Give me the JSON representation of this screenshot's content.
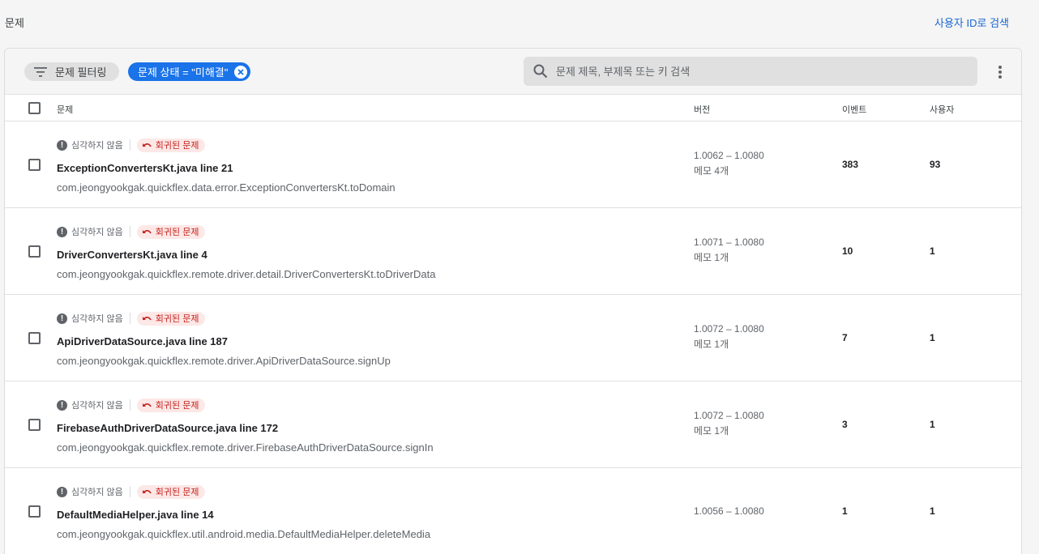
{
  "page_title": "문제",
  "search_by_id_link": "사용자 ID로 검색",
  "toolbar": {
    "filter_chip_label": "문제 필터링",
    "status_chip_label": "문제 상태 = \"미해결\"",
    "search_placeholder": "문제 제목, 부제목 또는 키 검색"
  },
  "columns": {
    "issue": "문제",
    "version": "버전",
    "events": "이벤트",
    "users": "사용자"
  },
  "colors": {
    "accent": "#1a73e8",
    "link": "#1967d2",
    "regressed_bg": "#fce8e6",
    "regressed_text": "#c5221f"
  },
  "issues": [
    {
      "severity": "심각하지 않음",
      "badge": "회귀된 문제",
      "title": "ExceptionConvertersKt.java line 21",
      "subtitle": "com.jeongyookgak.quickflex.data.error.ExceptionConvertersKt.toDomain",
      "version_range": "1.0062 – 1.0080",
      "notes": "메모 4개",
      "events": "383",
      "users": "93"
    },
    {
      "severity": "심각하지 않음",
      "badge": "회귀된 문제",
      "title": "DriverConvertersKt.java line 4",
      "subtitle": "com.jeongyookgak.quickflex.remote.driver.detail.DriverConvertersKt.toDriverData",
      "version_range": "1.0071 – 1.0080",
      "notes": "메모 1개",
      "events": "10",
      "users": "1"
    },
    {
      "severity": "심각하지 않음",
      "badge": "회귀된 문제",
      "title": "ApiDriverDataSource.java line 187",
      "subtitle": "com.jeongyookgak.quickflex.remote.driver.ApiDriverDataSource.signUp",
      "version_range": "1.0072 – 1.0080",
      "notes": "메모 1개",
      "events": "7",
      "users": "1"
    },
    {
      "severity": "심각하지 않음",
      "badge": "회귀된 문제",
      "title": "FirebaseAuthDriverDataSource.java line 172",
      "subtitle": "com.jeongyookgak.quickflex.remote.driver.FirebaseAuthDriverDataSource.signIn",
      "version_range": "1.0072 – 1.0080",
      "notes": "메모 1개",
      "events": "3",
      "users": "1"
    },
    {
      "severity": "심각하지 않음",
      "badge": "회귀된 문제",
      "title": "DefaultMediaHelper.java line 14",
      "subtitle": "com.jeongyookgak.quickflex.util.android.media.DefaultMediaHelper.deleteMedia",
      "version_range": "1.0056 – 1.0080",
      "notes": "",
      "events": "1",
      "users": "1"
    }
  ]
}
